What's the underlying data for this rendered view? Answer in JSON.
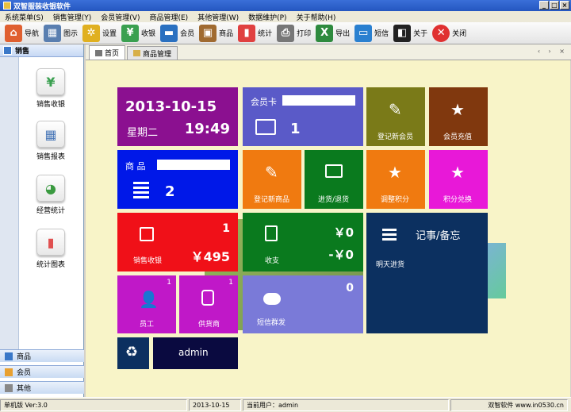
{
  "window": {
    "title": "双智服装收银软件"
  },
  "menu": [
    "系统菜单(S)",
    "销售管理(Y)",
    "会员管理(V)",
    "商品管理(E)",
    "其他管理(W)",
    "数据维护(P)",
    "关于帮助(H)"
  ],
  "toolbar": [
    {
      "label": "导航",
      "icon": "home-icon"
    },
    {
      "label": "图示",
      "icon": "calendar-icon"
    },
    {
      "label": "设置",
      "icon": "gear-icon"
    },
    {
      "label": "收银",
      "icon": "yen-icon"
    },
    {
      "label": "会员",
      "icon": "card-icon"
    },
    {
      "label": "商品",
      "icon": "box-icon"
    },
    {
      "label": "统计",
      "icon": "bar-chart-icon"
    },
    {
      "label": "打印",
      "icon": "printer-icon"
    },
    {
      "label": "导出",
      "icon": "excel-icon"
    },
    {
      "label": "短信",
      "icon": "sms-icon"
    },
    {
      "label": "关于",
      "icon": "about-icon"
    },
    {
      "label": "关闭",
      "icon": "close-icon"
    }
  ],
  "sidebar": {
    "header": "销售",
    "items": [
      {
        "label": "销售收银",
        "icon": "yen-icon"
      },
      {
        "label": "销售报表",
        "icon": "table-icon"
      },
      {
        "label": "经营统计",
        "icon": "pie-chart-icon"
      },
      {
        "label": "统计图表",
        "icon": "bar-chart-icon"
      }
    ],
    "bottom": [
      {
        "label": "商品",
        "color": "#3a78c8"
      },
      {
        "label": "会员",
        "color": "#e8a030"
      },
      {
        "label": "其他",
        "color": "#888888"
      }
    ]
  },
  "tabs": [
    {
      "label": "首页",
      "active": true
    },
    {
      "label": "商品管理",
      "active": false
    }
  ],
  "tiles": {
    "date": {
      "date": "2013-10-15",
      "weekday": "星期二",
      "time": "19:49"
    },
    "member_card": {
      "label": "会员卡",
      "count": "1"
    },
    "register_member": "登记新会员",
    "member_recharge": "会员充值",
    "product": {
      "label": "商 品",
      "count": "2"
    },
    "register_product": "登记新商品",
    "stock_in_out": "进货/退货",
    "adjust_points": "调整积分",
    "points_exchange": "积分兑换",
    "sales_checkout": {
      "label": "销售收银",
      "count": "1",
      "amount": "￥495"
    },
    "income_expense": {
      "label": "收支",
      "income": "￥0",
      "expense": "-￥0"
    },
    "notes": {
      "title": "记事/备忘",
      "text": "明天进货"
    },
    "staff": {
      "label": "员工",
      "count": "1"
    },
    "supplier": {
      "label": "供货商",
      "count": "1"
    },
    "sms_broadcast": {
      "label": "短信群发",
      "count": "0"
    },
    "user": "admin"
  },
  "status": {
    "version": "单机版 Ver:3.0",
    "date": "2013-10-15",
    "current_user": "当前用户：admin",
    "vendor": "双智软件 www.in0530.cn"
  }
}
